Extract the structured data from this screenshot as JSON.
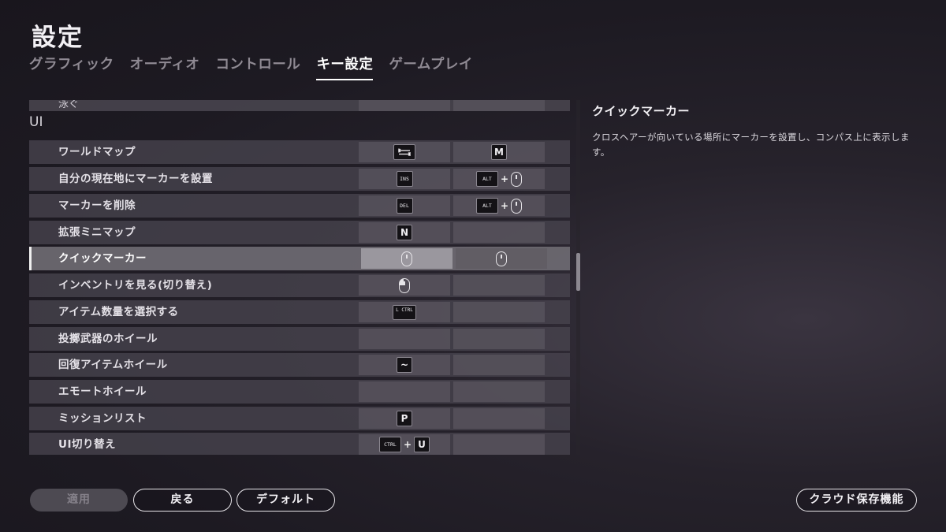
{
  "title": "設定",
  "tabs": [
    {
      "label": "グラフィック"
    },
    {
      "label": "オーディオ"
    },
    {
      "label": "コントロール"
    },
    {
      "label": "キー設定"
    },
    {
      "label": "ゲームプレイ"
    }
  ],
  "active_tab": "キー設定",
  "partial_row": {
    "label": "泳ぐ"
  },
  "section": "UI",
  "rows": [
    {
      "label": "ワールドマップ"
    },
    {
      "label": "自分の現在地にマーカーを設置"
    },
    {
      "label": "マーカーを削除"
    },
    {
      "label": "拡張ミニマップ"
    },
    {
      "label": "クイックマーカー"
    },
    {
      "label": "インベントリを見る(切り替え)"
    },
    {
      "label": "アイテム数量を選択する"
    },
    {
      "label": "投擲武器のホイール"
    },
    {
      "label": "回復アイテムホイール"
    },
    {
      "label": "エモートホイール"
    },
    {
      "label": "ミッションリスト"
    },
    {
      "label": "UI切り替え"
    }
  ],
  "keys": {
    "worldmap_alt": "M",
    "marker_set_primary": "INS",
    "marker_set_mod": "ALT",
    "marker_del_primary": "DEL",
    "marker_del_mod": "ALT",
    "minimap": "N",
    "item_qty": "L CTRL",
    "heal_wheel": "~",
    "mission": "P",
    "ui_mod": "CTRL",
    "ui_key": "U",
    "plus": "+"
  },
  "detail": {
    "title": "クイックマーカー",
    "text": "クロスヘアーが向いている場所にマーカーを設置し、コンパス上に表示します。"
  },
  "buttons": {
    "apply": "適用",
    "back": "戻る",
    "default": "デフォルト",
    "cloud": "クラウド保存機能"
  }
}
